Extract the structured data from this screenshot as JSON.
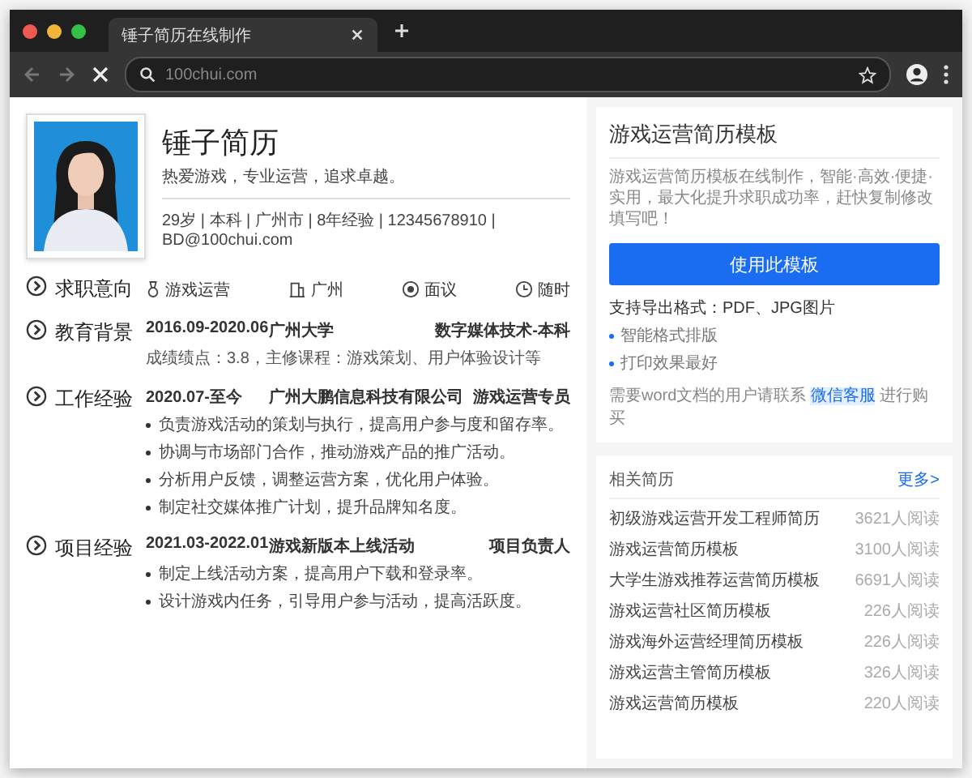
{
  "browser": {
    "tab_title": "锤子简历在线制作",
    "address": "100chui.com"
  },
  "resume": {
    "name": "锤子简历",
    "tagline": "热爱游戏，专业运营，追求卓越。",
    "info": "29岁 | 本科 | 广州市 | 8年经验 | 12345678910 | BD@100chui.com",
    "sections": [
      {
        "kind": "intention",
        "title": "求职意向",
        "items": [
          "游戏运营",
          "广州",
          "面议",
          "随时"
        ]
      },
      {
        "kind": "entry",
        "title": "教育背景",
        "date": "2016.09-2020.06",
        "org": "广州大学",
        "role": "数字媒体技术-本科",
        "detail": "成绩绩点：3.8，主修课程：游戏策划、用户体验设计等"
      },
      {
        "kind": "entry",
        "title": "工作经验",
        "date": "2020.07-至今",
        "org": "广州大鹏信息科技有限公司",
        "role": "游戏运营专员",
        "bullets": [
          "负责游戏活动的策划与执行，提高用户参与度和留存率。",
          "协调与市场部门合作，推动游戏产品的推广活动。",
          "分析用户反馈，调整运营方案，优化用户体验。",
          "制定社交媒体推广计划，提升品牌知名度。"
        ]
      },
      {
        "kind": "entry",
        "title": "项目经验",
        "date": "2021.03-2022.01",
        "org": "游戏新版本上线活动",
        "role": "项目负责人",
        "bullets": [
          "制定上线活动方案，提高用户下载和登录率。",
          "设计游戏内任务，引导用户参与活动，提高活跃度。"
        ]
      }
    ]
  },
  "sidebar": {
    "title": "游戏运营简历模板",
    "description": "游戏运营简历模板在线制作，智能·高效·便捷·实用，最大化提升求职成功率，赶快复制修改填写吧！",
    "button": "使用此模板",
    "formats": "支持导出格式：PDF、JPG图片",
    "features": [
      "智能格式排版",
      "打印效果最好"
    ],
    "contact": {
      "before": "需要word文档的用户请联系",
      "link": "微信客服",
      "after": "进行购买"
    },
    "related": {
      "title": "相关简历",
      "more": "更多>",
      "items": [
        {
          "title": "初级游戏运营开发工程师简历",
          "reads": "3621人阅读"
        },
        {
          "title": "游戏运营简历模板",
          "reads": "3100人阅读"
        },
        {
          "title": "大学生游戏推荐运营简历模板",
          "reads": "6691人阅读"
        },
        {
          "title": "游戏运营社区简历模板",
          "reads": "226人阅读"
        },
        {
          "title": "游戏海外运营经理简历模板",
          "reads": "226人阅读"
        },
        {
          "title": "游戏运营主管简历模板",
          "reads": "326人阅读"
        },
        {
          "title": "游戏运营简历模板",
          "reads": "220人阅读"
        }
      ]
    }
  }
}
